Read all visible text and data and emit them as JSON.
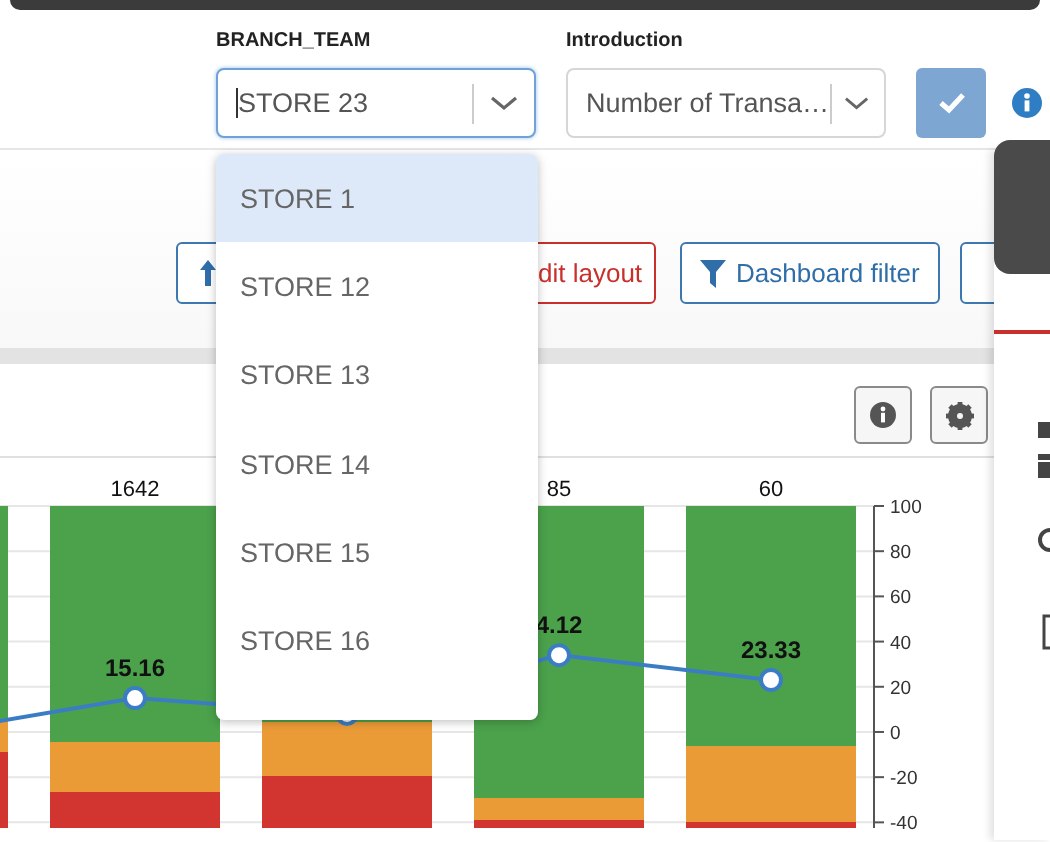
{
  "filters": [
    {
      "label": "BRANCH_TEAM",
      "value": "STORE 23",
      "focused": true
    },
    {
      "label": "Introduction",
      "value": "Number of Transa…",
      "focused": false
    }
  ],
  "dropdown": {
    "options": [
      {
        "label": "STORE 1",
        "selected": true
      },
      {
        "label": "STORE 12",
        "selected": false
      },
      {
        "label": "STORE 13",
        "selected": false
      },
      {
        "label": "STORE 14",
        "selected": false
      },
      {
        "label": "STORE 15",
        "selected": false
      },
      {
        "label": "STORE 16",
        "selected": false
      }
    ]
  },
  "toolbar": {
    "buttons": [
      {
        "kind": "upload"
      },
      {
        "kind": "danger",
        "label": "dit layout"
      },
      {
        "kind": "filter",
        "label": "Dashboard filter"
      },
      {
        "kind": "stub"
      }
    ]
  },
  "chart_panel": {
    "bars": [
      {
        "kind": "cut"
      },
      {
        "kind": "labeled",
        "total": "1642"
      },
      {
        "kind": "covered"
      },
      {
        "kind": "labeled",
        "total": "85"
      },
      {
        "kind": "labeled",
        "total": "60"
      }
    ],
    "axis_labels": [
      "100",
      "80",
      "60",
      "40",
      "20",
      "0",
      "-20",
      "-40"
    ],
    "points": [
      {
        "kind": "cut"
      },
      {
        "kind": "labeled",
        "label": "15.16"
      },
      {
        "kind": "covered"
      },
      {
        "kind": "labeled",
        "label": "4.12"
      },
      {
        "kind": "labeled",
        "label": "23.33"
      }
    ]
  }
}
